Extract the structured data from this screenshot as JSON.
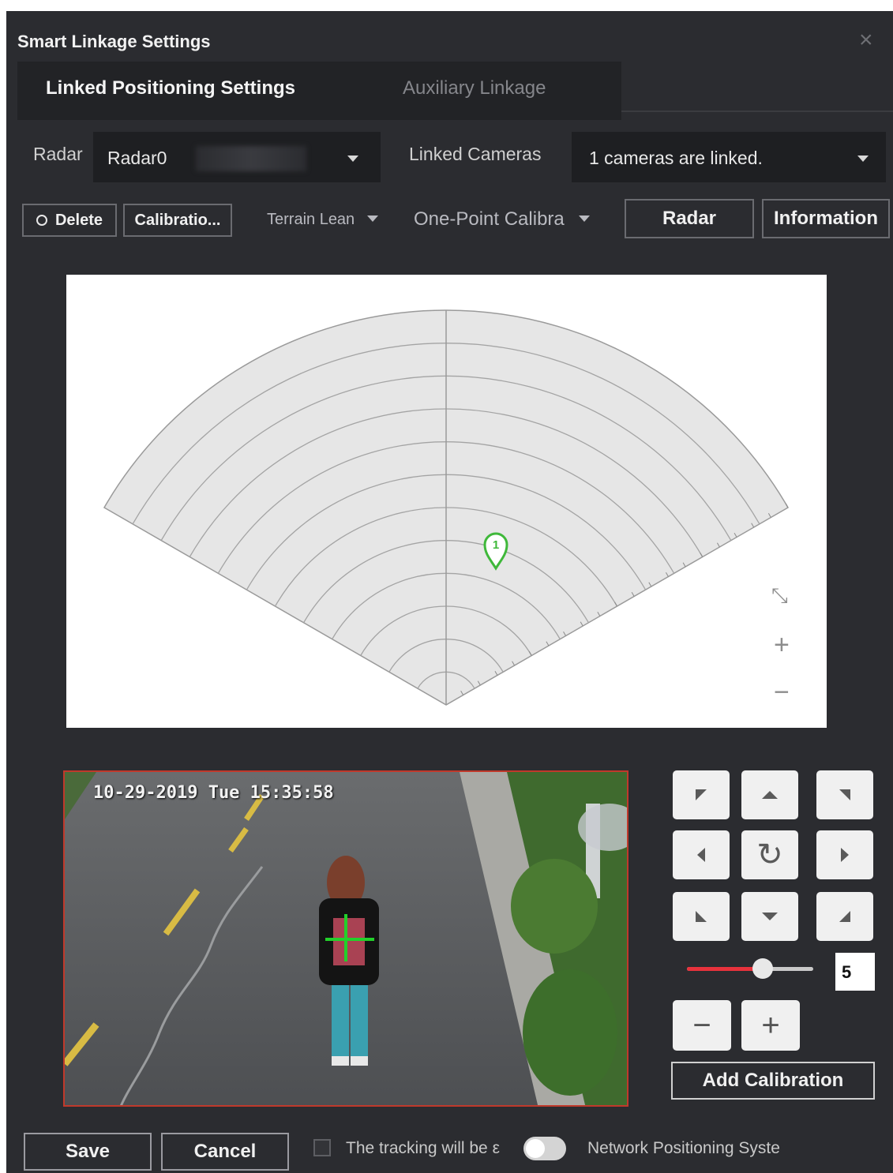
{
  "dialog": {
    "title": "Smart Linkage Settings",
    "close_icon": "close-icon"
  },
  "tabs": [
    {
      "label": "Linked Positioning Settings",
      "active": true
    },
    {
      "label": "Auxiliary Linkage",
      "active": false
    }
  ],
  "radar_select": {
    "label": "Radar",
    "value": "Radar0"
  },
  "cameras_select": {
    "label": "Linked Cameras",
    "value": "1 cameras are linked."
  },
  "toolbar": {
    "delete_label": "Delete",
    "calibration_label": "Calibratio...",
    "terrain_label": "Terrain Lean",
    "one_point_label": "One-Point Calibra",
    "radar_label": "Radar",
    "information_label": "Information"
  },
  "radar_map": {
    "marker_label": "1",
    "marker_color": "#3fb83a",
    "zoom_in": "+",
    "zoom_out": "−"
  },
  "video": {
    "osd_text": "10-29-2019 Tue 15:35:58"
  },
  "ptz": {
    "speed_value": "5",
    "speed_level": 0.6,
    "accent_color": "#e8323c",
    "zoom_out_label": "−",
    "zoom_in_label": "+",
    "add_calibration_label": "Add Calibration"
  },
  "footer": {
    "save_label": "Save",
    "cancel_label": "Cancel",
    "tracking_text": "The tracking will be ε",
    "network_text": "Network Positioning Syste"
  }
}
